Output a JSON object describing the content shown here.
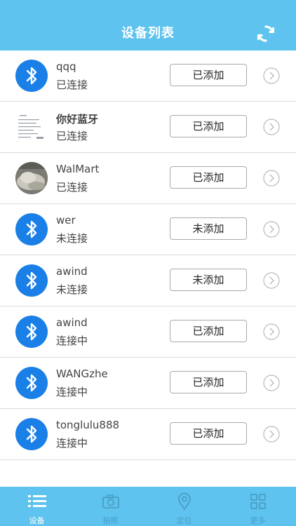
{
  "header": {
    "title": "设备列表",
    "refresh_icon": "refresh-icon"
  },
  "devices": [
    {
      "name": "qqq",
      "status": "已连接",
      "button": "已添加",
      "avatar": "bluetooth-icon"
    },
    {
      "name": "你好蓝牙",
      "status": "已连接",
      "button": "已添加",
      "avatar": "document-thumbnail"
    },
    {
      "name": "WalMart",
      "status": "已连接",
      "button": "已添加",
      "avatar": "photo-thumbnail"
    },
    {
      "name": "wer",
      "status": "未连接",
      "button": "未添加",
      "avatar": "bluetooth-icon"
    },
    {
      "name": "awind",
      "status": "未连接",
      "button": "未添加",
      "avatar": "bluetooth-icon"
    },
    {
      "name": "awind",
      "status": "连接中",
      "button": "已添加",
      "avatar": "bluetooth-icon"
    },
    {
      "name": "WANGzhe",
      "status": "连接中",
      "button": "已添加",
      "avatar": "bluetooth-icon"
    },
    {
      "name": "tonglulu888",
      "status": "连接中",
      "button": "已添加",
      "avatar": "bluetooth-icon"
    }
  ],
  "tabs": [
    {
      "label": "设备",
      "icon": "list-icon",
      "active": true
    },
    {
      "label": "拍照",
      "icon": "camera-icon",
      "active": false
    },
    {
      "label": "定位",
      "icon": "location-pin-icon",
      "active": false
    },
    {
      "label": "更多",
      "icon": "grid-icon",
      "active": false
    }
  ],
  "colors": {
    "header": "#5ec3ee",
    "bluetooth": "#1a7fe6",
    "text": "#444444",
    "divider": "#dcdcdc"
  }
}
